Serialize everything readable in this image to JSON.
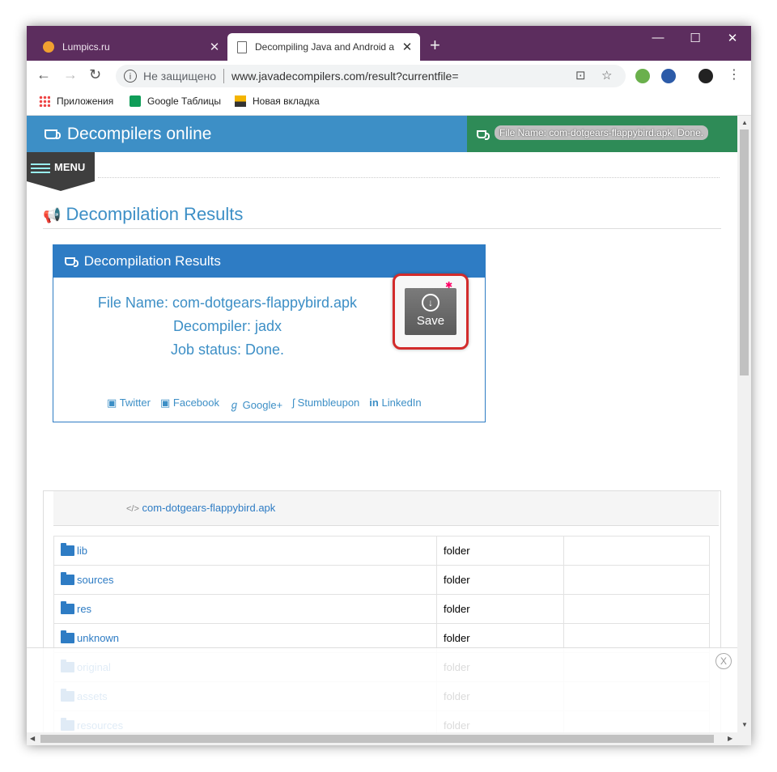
{
  "browser": {
    "tabs": [
      {
        "title": "Lumpics.ru",
        "favicon_color": "#f0a030",
        "active": false
      },
      {
        "title": "Decompiling Java and Android a",
        "active": true
      }
    ],
    "new_tab": "+",
    "window_controls": {
      "minimize": "—",
      "maximize": "☐",
      "close": "✕"
    },
    "nav": {
      "back": "←",
      "forward": "→",
      "reload": "↻"
    },
    "security_label": "Не защищено",
    "url": "www.javadecompilers.com/result?currentfile=",
    "bookmarks": [
      {
        "label": "Приложения",
        "icon": "apps-grid-icon"
      },
      {
        "label": "Google Таблицы",
        "icon": "sheets-icon"
      },
      {
        "label": "Новая вкладка",
        "icon": "image-icon"
      }
    ]
  },
  "site": {
    "brand": "Decompilers online",
    "status_pill": "File Name: com-dotgears-flappybird.apk, Done.",
    "menu_label": "MENU",
    "section_title": "Decompilation Results",
    "panel": {
      "title": "Decompilation Results",
      "file_name": "File Name: com-dotgears-flappybird.apk",
      "decompiler": "Decompiler: jadx",
      "job_status": "Job status: Done.",
      "save_label": "Save",
      "social": [
        "Twitter",
        "Facebook",
        "Google+",
        "Stumbleupon",
        "LinkedIn"
      ]
    },
    "files": {
      "archive_name": "com-dotgears-flappybird.apk",
      "rows": [
        {
          "name": "lib",
          "type": "folder"
        },
        {
          "name": "sources",
          "type": "folder"
        },
        {
          "name": "res",
          "type": "folder"
        },
        {
          "name": "unknown",
          "type": "folder"
        },
        {
          "name": "original",
          "type": "folder"
        },
        {
          "name": "assets",
          "type": "folder"
        },
        {
          "name": "resources",
          "type": "folder"
        }
      ]
    },
    "overlay_close": "X"
  },
  "colors": {
    "titlebar": "#5c2d5e",
    "header_blue": "#3d8fc6",
    "header_green": "#2e8b57",
    "panel_blue": "#2e7cc4",
    "highlight_red": "#d22b2b"
  }
}
